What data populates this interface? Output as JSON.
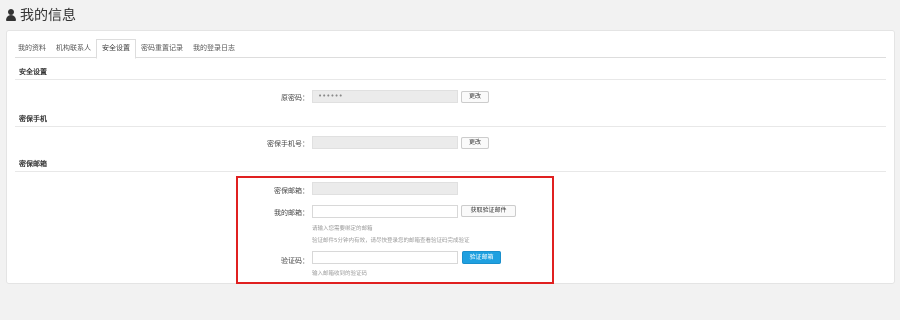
{
  "page": {
    "title": "我的信息",
    "icon": "user-icon"
  },
  "tabs": [
    {
      "label": "我的资料",
      "active": false
    },
    {
      "label": "机构联系人",
      "active": false
    },
    {
      "label": "安全设置",
      "active": true
    },
    {
      "label": "密码重置记录",
      "active": false
    },
    {
      "label": "我的登录日志",
      "active": false
    }
  ],
  "security": {
    "title": "安全设置",
    "password_label": "原密码：",
    "password_value": "••••••",
    "password_button": "更改"
  },
  "phone": {
    "title": "密保手机",
    "phone_label": "密保手机号：",
    "phone_value": "",
    "phone_button": "更改"
  },
  "email": {
    "title": "密保邮箱",
    "secure_email_label": "密保邮箱：",
    "secure_email_value": "",
    "my_email_label": "我的邮箱：",
    "my_email_value": "",
    "get_mail_button": "获取验证邮件",
    "hint1": "请输入您需要绑定的邮箱",
    "hint2": "验证邮件5分钟内有效，请尽快登录您的邮箱查看验证码完成验证",
    "code_label": "验证码：",
    "code_value": "",
    "verify_button": "验证邮箱",
    "code_hint": "输入邮箱收到的验证码"
  },
  "highlight_color": "#e02020",
  "accent_color": "#1fa0e0"
}
